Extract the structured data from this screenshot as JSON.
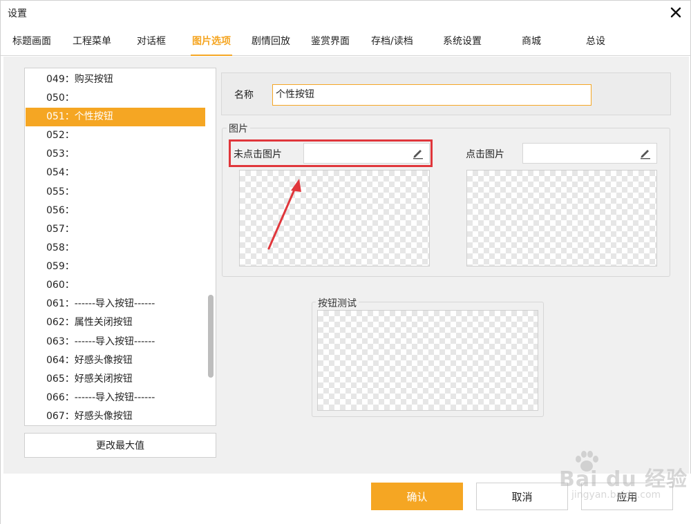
{
  "window": {
    "title": "设置"
  },
  "tabs": [
    {
      "label": "标题画面"
    },
    {
      "label": "工程菜单"
    },
    {
      "label": "对话框"
    },
    {
      "label": "图片选项",
      "active": true
    },
    {
      "label": "剧情回放"
    },
    {
      "label": "鉴赏界面"
    },
    {
      "label": "存档/读档"
    },
    {
      "label": "系统设置"
    },
    {
      "label": "商城"
    },
    {
      "label": "总设"
    }
  ],
  "list": {
    "items": [
      "049：购买按钮",
      "050：",
      "051：个性按钮",
      "052：",
      "053：",
      "054：",
      "055：",
      "056：",
      "057：",
      "058：",
      "059：",
      "060：",
      "061：------导入按钮------",
      "062：属性关闭按钮",
      "063：------导入按钮------",
      "064：好感头像按钮",
      "065：好感关闭按钮",
      "066：------导入按钮------",
      "067：好感头像按钮"
    ],
    "selected_index": 2,
    "max_button": "更改最大值"
  },
  "name_field": {
    "label": "名称",
    "value": "个性按钮"
  },
  "image_group": {
    "title": "图片",
    "unclicked_label": "未点击图片",
    "clicked_label": "点击图片"
  },
  "test_group": {
    "title": "按钮测试"
  },
  "buttons": {
    "confirm": "确认",
    "cancel": "取消",
    "apply": "应用"
  },
  "watermark": {
    "text": "Bai du 经验",
    "sub": "jingyan.baidu.com"
  },
  "colors": {
    "accent": "#f5a623",
    "highlight": "#e0363b"
  },
  "icons": {
    "close": "close-icon",
    "edit": "pencil-icon"
  }
}
